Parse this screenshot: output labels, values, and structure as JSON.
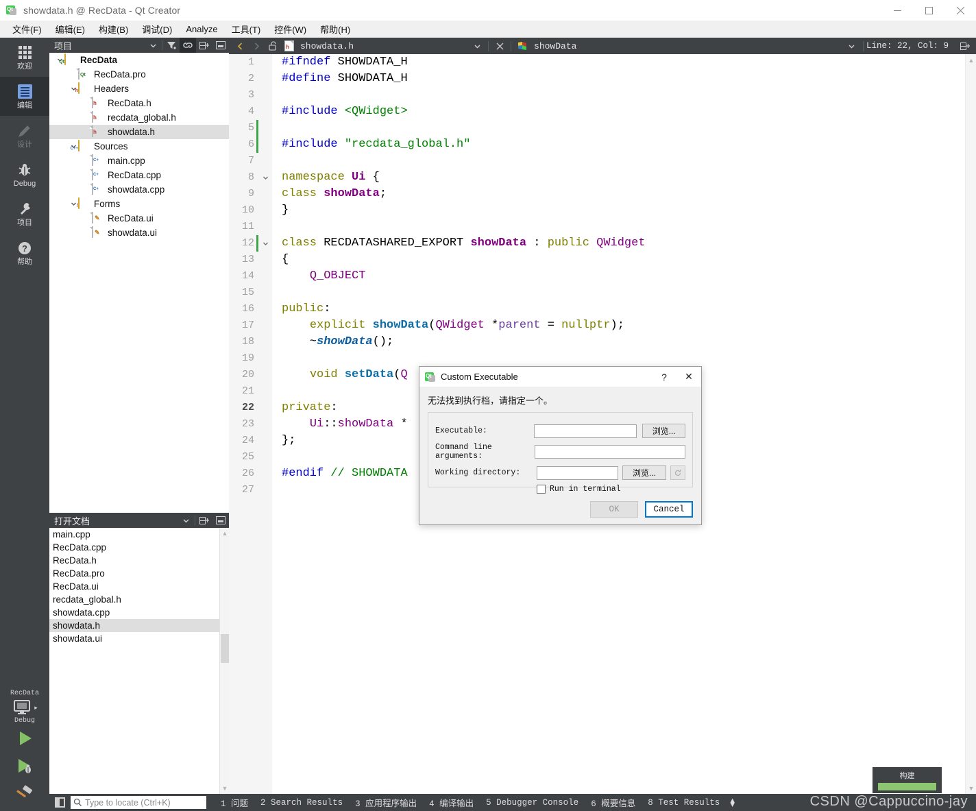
{
  "window": {
    "title": "showdata.h @ RecData - Qt Creator",
    "minimize": "—",
    "maximize": "□",
    "close": "✕"
  },
  "menubar": {
    "items": [
      {
        "label": "文件(F)"
      },
      {
        "label": "编辑(E)"
      },
      {
        "label": "构建(B)"
      },
      {
        "label": "调试(D)"
      },
      {
        "label": "Analyze"
      },
      {
        "label": "工具(T)"
      },
      {
        "label": "控件(W)"
      },
      {
        "label": "帮助(H)"
      }
    ]
  },
  "modebar": {
    "items": [
      {
        "label": "欢迎",
        "icon": "grid-icon",
        "active": false
      },
      {
        "label": "编辑",
        "icon": "document-edit-icon",
        "active": true
      },
      {
        "label": "设计",
        "icon": "pencil-icon",
        "active": false
      },
      {
        "label": "Debug",
        "icon": "bug-icon",
        "active": false
      },
      {
        "label": "项目",
        "icon": "wrench-icon",
        "active": false
      },
      {
        "label": "帮助",
        "icon": "question-mark-icon",
        "active": false
      }
    ],
    "run_kit": {
      "project": "RecData",
      "build_config": "Debug",
      "monitor_icon": "desktop-icon",
      "run_icon": "play-icon",
      "debug_icon": "play-bug-icon",
      "build_icon": "hammer-icon"
    }
  },
  "project_panel": {
    "title": "项目",
    "toolbar": [
      {
        "name": "dropdown",
        "icon": "chevron-down-icon"
      },
      {
        "name": "filter",
        "icon": "filter-icon"
      },
      {
        "name": "sync",
        "icon": "link-icon",
        "active": true
      },
      {
        "name": "split",
        "icon": "split-add-icon"
      },
      {
        "name": "close",
        "icon": "panel-close-icon"
      }
    ],
    "tree": [
      {
        "label": "RecData",
        "depth": 0,
        "chevron": "down",
        "icon": "qt-project-icon",
        "bold": true,
        "selected": false
      },
      {
        "label": "RecData.pro",
        "depth": 1,
        "chevron": "",
        "icon": "qt-pro-icon",
        "bold": false,
        "selected": false
      },
      {
        "label": "Headers",
        "depth": 1,
        "chevron": "down",
        "icon": "folder-h-icon",
        "bold": false,
        "selected": false
      },
      {
        "label": "RecData.h",
        "depth": 2,
        "chevron": "",
        "icon": "header-icon",
        "bold": false,
        "selected": false
      },
      {
        "label": "recdata_global.h",
        "depth": 2,
        "chevron": "",
        "icon": "header-icon",
        "bold": false,
        "selected": false
      },
      {
        "label": "showdata.h",
        "depth": 2,
        "chevron": "",
        "icon": "header-icon",
        "bold": false,
        "selected": true
      },
      {
        "label": "Sources",
        "depth": 1,
        "chevron": "down",
        "icon": "folder-cpp-icon",
        "bold": false,
        "selected": false
      },
      {
        "label": "main.cpp",
        "depth": 2,
        "chevron": "",
        "icon": "cpp-icon",
        "bold": false,
        "selected": false
      },
      {
        "label": "RecData.cpp",
        "depth": 2,
        "chevron": "",
        "icon": "cpp-icon",
        "bold": false,
        "selected": false
      },
      {
        "label": "showdata.cpp",
        "depth": 2,
        "chevron": "",
        "icon": "cpp-icon",
        "bold": false,
        "selected": false
      },
      {
        "label": "Forms",
        "depth": 1,
        "chevron": "down",
        "icon": "folder-ui-icon",
        "bold": false,
        "selected": false
      },
      {
        "label": "RecData.ui",
        "depth": 2,
        "chevron": "",
        "icon": "ui-icon",
        "bold": false,
        "selected": false
      },
      {
        "label": "showdata.ui",
        "depth": 2,
        "chevron": "",
        "icon": "ui-icon",
        "bold": false,
        "selected": false
      }
    ]
  },
  "open_documents": {
    "title": "打开文档",
    "toolbar": [
      {
        "name": "dropdown",
        "icon": "chevron-down-icon"
      },
      {
        "name": "split",
        "icon": "split-add-icon"
      },
      {
        "name": "close",
        "icon": "panel-close-icon"
      }
    ],
    "items": [
      {
        "label": "main.cpp",
        "selected": false
      },
      {
        "label": "RecData.cpp",
        "selected": false
      },
      {
        "label": "RecData.h",
        "selected": false
      },
      {
        "label": "RecData.pro",
        "selected": false
      },
      {
        "label": "RecData.ui",
        "selected": false
      },
      {
        "label": "recdata_global.h",
        "selected": false
      },
      {
        "label": "showdata.cpp",
        "selected": false
      },
      {
        "label": "showdata.h",
        "selected": true
      },
      {
        "label": "showdata.ui",
        "selected": false
      }
    ]
  },
  "editor_toolbar": {
    "back_icon": "chevron-left-icon",
    "forward_icon": "chevron-right-icon",
    "lock_icon": "unlocked-icon",
    "file_icon": "header-icon",
    "document_name": "showdata.h",
    "document_dropdown_icon": "chevron-down-icon",
    "close_icon": "close-icon",
    "symbol_icon": "qt-class-icon",
    "symbol_name": "showData",
    "symbol_dropdown_icon": "chevron-down-icon",
    "line_col": "Line: 22, Col: 9",
    "split_icon": "split-add-icon"
  },
  "code": {
    "current_line": 22,
    "lines": [
      {
        "n": 1,
        "modified": false,
        "fold": "",
        "html": "<span class='k-pre'>#ifndef</span> <span class='k-id'>SHOWDATA_H</span>"
      },
      {
        "n": 2,
        "modified": false,
        "fold": "",
        "html": "<span class='k-pre'>#define</span> <span class='k-id'>SHOWDATA_H</span>"
      },
      {
        "n": 3,
        "modified": false,
        "fold": "",
        "html": ""
      },
      {
        "n": 4,
        "modified": false,
        "fold": "",
        "html": "<span class='k-pre'>#include</span> <span class='k-inc'>&lt;QWidget&gt;</span>"
      },
      {
        "n": 5,
        "modified": true,
        "fold": "",
        "html": ""
      },
      {
        "n": 6,
        "modified": true,
        "fold": "",
        "html": "<span class='k-pre'>#include</span> <span class='k-inc'>\"recdata_global.h\"</span>"
      },
      {
        "n": 7,
        "modified": false,
        "fold": "",
        "html": ""
      },
      {
        "n": 8,
        "modified": false,
        "fold": "down",
        "html": "<span class='k-kw'>namespace</span> <span class='k-typeb'>Ui</span> {"
      },
      {
        "n": 9,
        "modified": false,
        "fold": "",
        "html": "<span class='k-kw'>class</span> <span class='k-typeb'>showData</span>;"
      },
      {
        "n": 10,
        "modified": false,
        "fold": "",
        "html": "}"
      },
      {
        "n": 11,
        "modified": false,
        "fold": "",
        "html": ""
      },
      {
        "n": 12,
        "modified": true,
        "fold": "down",
        "html": "<span class='k-kw'>class</span> <span class='k-id'>RECDATASHARED_EXPORT</span> <span class='k-typeb'>showData</span> : <span class='k-kw'>public</span> <span class='k-type'>QWidget</span>"
      },
      {
        "n": 13,
        "modified": false,
        "fold": "",
        "html": "{"
      },
      {
        "n": 14,
        "modified": false,
        "fold": "",
        "html": "    <span class='k-type'>Q_OBJECT</span>"
      },
      {
        "n": 15,
        "modified": false,
        "fold": "",
        "html": ""
      },
      {
        "n": 16,
        "modified": false,
        "fold": "",
        "html": "<span class='k-kw'>public</span>:"
      },
      {
        "n": 17,
        "modified": false,
        "fold": "",
        "html": "    <span class='k-kw'>explicit</span> <span class='k-fn'>showData</span>(<span class='k-type'>QWidget</span> *<span class='k-prm'>parent</span> = <span class='k-kw'>nullptr</span>);"
      },
      {
        "n": 18,
        "modified": false,
        "fold": "",
        "html": "    ~<span class='k-typei'>showData</span>();"
      },
      {
        "n": 19,
        "modified": false,
        "fold": "",
        "html": ""
      },
      {
        "n": 20,
        "modified": false,
        "fold": "",
        "html": "    <span class='k-kw'>void</span> <span class='k-fn'>setData</span>(<span class='k-type'>Q</span>"
      },
      {
        "n": 21,
        "modified": false,
        "fold": "",
        "html": ""
      },
      {
        "n": 22,
        "modified": false,
        "fold": "",
        "html": "<span class='k-kw'>private</span>:"
      },
      {
        "n": 23,
        "modified": false,
        "fold": "",
        "html": "    <span class='k-type'>Ui</span><span class='k-op'>::</span><span class='k-fld'>showData</span> *"
      },
      {
        "n": 24,
        "modified": false,
        "fold": "",
        "html": "};"
      },
      {
        "n": 25,
        "modified": false,
        "fold": "",
        "html": ""
      },
      {
        "n": 26,
        "modified": false,
        "fold": "",
        "html": "<span class='k-pre'>#endif</span> <span class='k-com'>// SHOWDATA</span>"
      },
      {
        "n": 27,
        "modified": false,
        "fold": "",
        "html": ""
      }
    ]
  },
  "dialog": {
    "title": "Custom Executable",
    "icon": "qt-icon",
    "help_button": "?",
    "close_button": "✕",
    "message": "无法找到执行档，请指定一个。",
    "fields": [
      {
        "label": "Executable:",
        "value": "",
        "browse": "浏览..."
      },
      {
        "label": "Command line arguments:",
        "value": ""
      },
      {
        "label": "Working directory:",
        "value": "",
        "browse": "浏览...",
        "reset_icon": "reset-icon"
      }
    ],
    "checkbox": {
      "label": "Run in terminal",
      "checked": false
    },
    "ok_label": "OK",
    "ok_enabled": false,
    "cancel_label": "Cancel"
  },
  "statusbar": {
    "toggle_icon": "sidebar-toggle-icon",
    "locator_placeholder": "Type to locate (Ctrl+K)",
    "locator_icon": "search-icon",
    "panes": [
      {
        "num": "1",
        "label": "问题"
      },
      {
        "num": "2",
        "label": "Search Results"
      },
      {
        "num": "3",
        "label": "应用程序输出"
      },
      {
        "num": "4",
        "label": "编译输出"
      },
      {
        "num": "5",
        "label": "Debugger Console"
      },
      {
        "num": "6",
        "label": "概要信息"
      },
      {
        "num": "8",
        "label": "Test Results"
      }
    ]
  },
  "progress": {
    "label": "构建",
    "percent": 100
  },
  "watermark": "CSDN @Cappuccino-jay",
  "colors": {
    "dark_chrome": "#3f4245",
    "accent_blue": "#0078d7",
    "qt_green": "#41cd52",
    "progress_green": "#8ec571",
    "modified_marker": "#3fa34a",
    "selection": "#dedede"
  }
}
